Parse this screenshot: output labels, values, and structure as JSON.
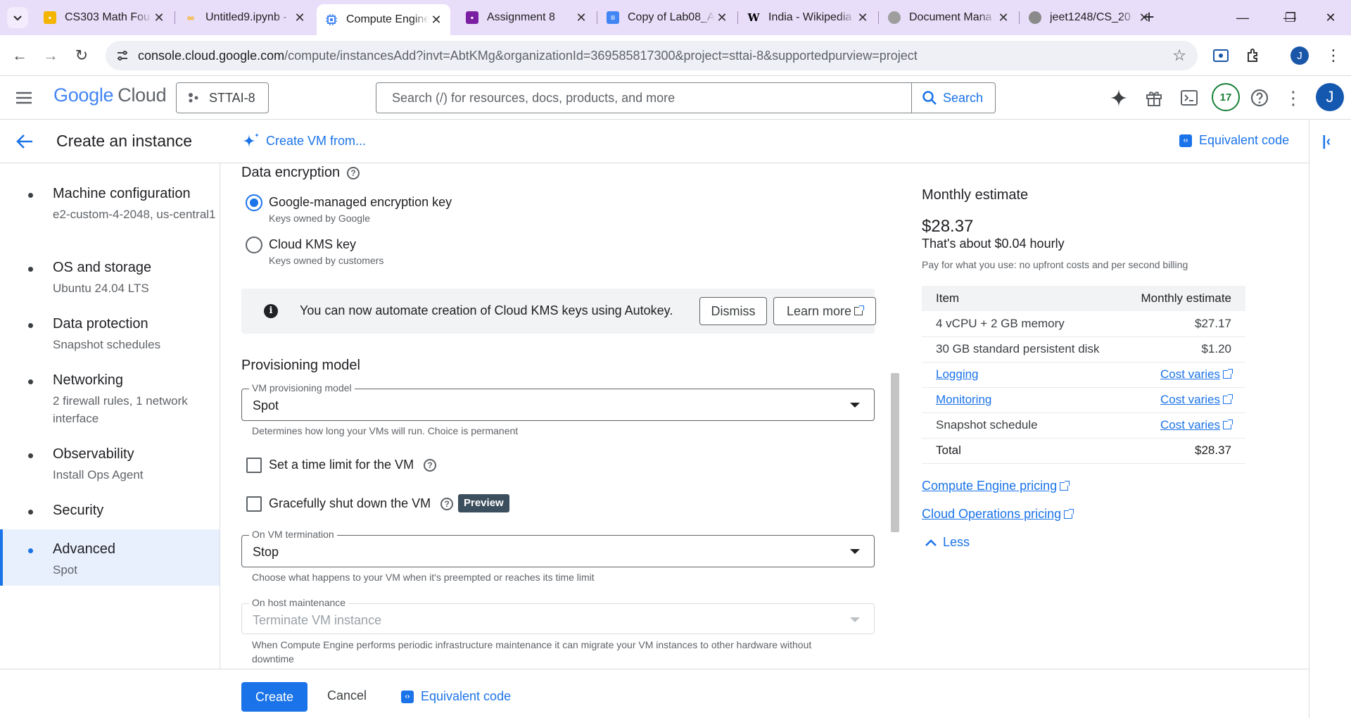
{
  "browser": {
    "tabs": [
      {
        "title": "CS303 Math Fou",
        "icon": "classroom-icon",
        "color": "#f4b400"
      },
      {
        "title": "Untitled9.ipynb -",
        "icon": "colab-icon",
        "color": "#f9ab00"
      },
      {
        "title": "Compute Engine",
        "icon": "compute-engine-icon",
        "color": "#4285f4"
      },
      {
        "title": "Assignment 8",
        "icon": "forms-icon",
        "color": "#7b1fa2"
      },
      {
        "title": "Copy of Lab08_A",
        "icon": "docs-icon",
        "color": "#4285f4"
      },
      {
        "title": "India - Wikipedia",
        "icon": "wikipedia-icon",
        "color": "#000000"
      },
      {
        "title": "Document Mana",
        "icon": "globe-icon",
        "color": "#9e9e9e"
      },
      {
        "title": "jeet1248/CS_20",
        "icon": "github-icon",
        "color": "#9e9e9e"
      }
    ],
    "active_tab": 2,
    "url_host": "console.cloud.google.com",
    "url_path": "/compute/instancesAdd?invt=AbtKMg&organizationId=369585817300&project=sttai-8&supportedpurview=project",
    "profile_initial": "J"
  },
  "header": {
    "logo_google": "Google",
    "logo_cloud": "Cloud",
    "project": "STTAI-8",
    "search_placeholder": "Search (/) for resources, docs, products, and more",
    "search_button": "Search",
    "notifications": "17",
    "avatar_initial": "J"
  },
  "titlebar": {
    "title": "Create an instance",
    "create_from": "Create VM from...",
    "equivalent_code": "Equivalent code"
  },
  "nav": [
    {
      "label": "Machine configuration",
      "sub": "e2-custom-4-2048, us-central1"
    },
    {
      "label": "OS and storage",
      "sub": "Ubuntu 24.04 LTS"
    },
    {
      "label": "Data protection",
      "sub": "Snapshot schedules"
    },
    {
      "label": "Networking",
      "sub": "2 firewall rules, 1 network interface"
    },
    {
      "label": "Observability",
      "sub": "Install Ops Agent"
    },
    {
      "label": "Security",
      "sub": ""
    },
    {
      "label": "Advanced",
      "sub": "Spot"
    }
  ],
  "form": {
    "encryption_title": "Data encryption",
    "opt_google_label": "Google-managed encryption key",
    "opt_google_sub": "Keys owned by Google",
    "opt_kms_label": "Cloud KMS key",
    "opt_kms_sub": "Keys owned by customers",
    "banner_text": "You can now automate creation of Cloud KMS keys using Autokey.",
    "dismiss": "Dismiss",
    "learn_more": "Learn more",
    "provisioning_title": "Provisioning model",
    "prov_field_label": "VM provisioning model",
    "prov_value": "Spot",
    "prov_hint": "Determines how long your VMs will run. Choice is permanent",
    "time_limit_label": "Set a time limit for the VM",
    "graceful_label": "Gracefully shut down the VM",
    "preview_badge": "Preview",
    "termination_label": "On VM termination",
    "termination_value": "Stop",
    "termination_hint": "Choose what happens to your VM when it's preempted or reaches its time limit",
    "host_label": "On host maintenance",
    "host_value": "Terminate VM instance",
    "host_hint": "When Compute Engine performs periodic infrastructure maintenance it can migrate your VM instances to other hardware without downtime"
  },
  "estimate": {
    "title": "Monthly estimate",
    "amount": "$28.37",
    "hourly": "That's about $0.04 hourly",
    "note": "Pay for what you use: no upfront costs and per second billing",
    "col_item": "Item",
    "col_estimate": "Monthly estimate",
    "rows": [
      {
        "item": "4 vCPU + 2 GB memory",
        "cost": "$27.17"
      },
      {
        "item": "30 GB standard persistent disk",
        "cost": "$1.20"
      },
      {
        "item": "Logging",
        "cost": "Cost varies"
      },
      {
        "item": "Monitoring",
        "cost": "Cost varies"
      },
      {
        "item": "Snapshot schedule",
        "cost": "Cost varies"
      },
      {
        "item": "Total",
        "cost": "$28.37"
      }
    ],
    "link_compute": "Compute Engine pricing",
    "link_ops": "Cloud Operations pricing",
    "less": "Less"
  },
  "footer": {
    "create": "Create",
    "cancel": "Cancel",
    "equivalent_code": "Equivalent code"
  }
}
